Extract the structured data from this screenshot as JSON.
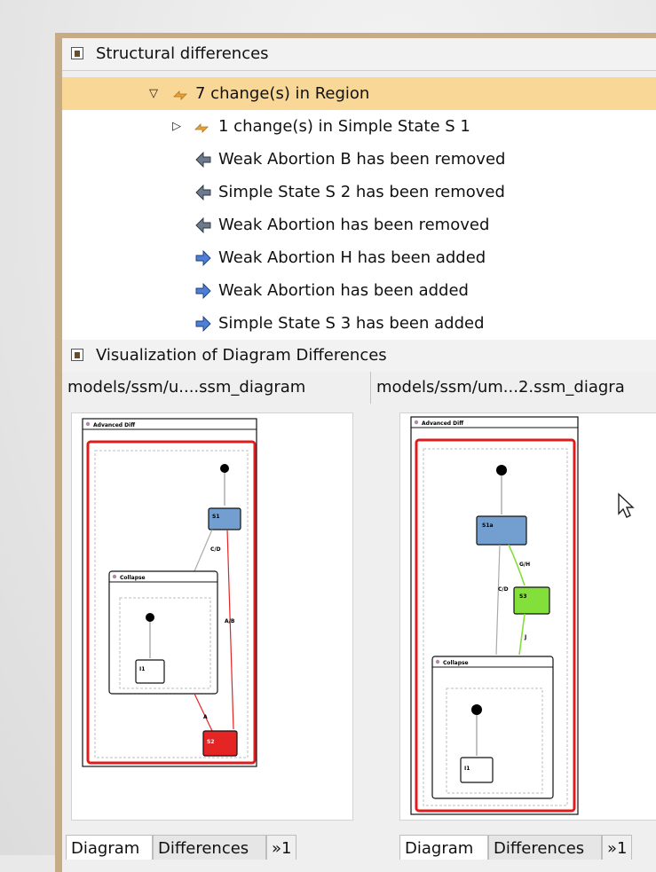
{
  "structural": {
    "title": "Structural differences",
    "items": [
      {
        "label": "7 change(s) in Region",
        "kind": "group",
        "expanded": true
      },
      {
        "label": "1 change(s) in Simple State S 1",
        "kind": "group",
        "expanded": false
      },
      {
        "label": "Weak Abortion B has been removed",
        "kind": "removed"
      },
      {
        "label": "Simple State S 2 has been removed",
        "kind": "removed"
      },
      {
        "label": "Weak Abortion has been removed",
        "kind": "removed"
      },
      {
        "label": "Weak Abortion H has been added",
        "kind": "added"
      },
      {
        "label": "Weak Abortion has been added",
        "kind": "added"
      },
      {
        "label": "Simple State S 3 has been added",
        "kind": "added"
      }
    ]
  },
  "visualization": {
    "title": "Visualization of Diagram Differences",
    "left_tab": "models/ssm/u....ssm_diagram",
    "right_tab": "models/ssm/um...2.ssm_diagra",
    "bottom_tabs": {
      "diagram": "Diagram",
      "differences": "Differences",
      "more": "»1"
    },
    "left_diagram": {
      "title": "Advanced Diff",
      "state_s1": "S1",
      "composite": "Collapse",
      "state_inner": "I1",
      "state_removed": "S2",
      "edge1": "C/D",
      "edge2": "A/B",
      "edge3": "A"
    },
    "right_diagram": {
      "title": "Advanced Diff",
      "state_s1": "S1a",
      "state_added": "S3",
      "composite": "Collapse",
      "state_inner": "I1",
      "edge1": "G/H",
      "edge2": "C/D",
      "edge3": "J"
    }
  },
  "colors": {
    "selection": "#f8d797",
    "removed": "#e52424",
    "added": "#83e03b",
    "state_blue": "#729fcf",
    "highlight_red": "#e01b1b"
  }
}
